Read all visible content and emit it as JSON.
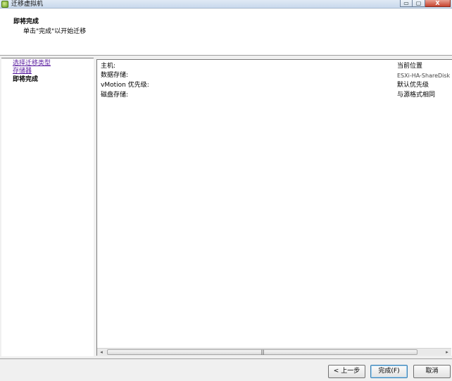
{
  "window": {
    "title": "迁移虚拟机",
    "buttons": {
      "minimize": "▭",
      "maximize": "▢",
      "close": "X"
    }
  },
  "header": {
    "title": "即将完成",
    "subtitle": "单击\"完成\"以开始迁移"
  },
  "steps": [
    {
      "label": "选择迁移类型",
      "state": "link"
    },
    {
      "label": "存储器",
      "state": "link"
    },
    {
      "label": "即将完成",
      "state": "current"
    }
  ],
  "summary": [
    {
      "label": "主机:",
      "value": "当前位置"
    },
    {
      "label": "数据存储:",
      "value": "ESXi-HA-ShareDisk"
    },
    {
      "label": "vMotion 优先级:",
      "value": "默认优先级"
    },
    {
      "label": "磁盘存储:",
      "value": "与源格式相同"
    }
  ],
  "scrollbar": {
    "left_arrow": "◂",
    "right_arrow": "▸",
    "grip": "|||"
  },
  "footer": {
    "back_label": "< 上一步",
    "finish_label": "完成(F)",
    "cancel_label": "取消"
  },
  "colors": {
    "link": "#5b1fa0",
    "default_button_border": "#3c7fb1"
  }
}
